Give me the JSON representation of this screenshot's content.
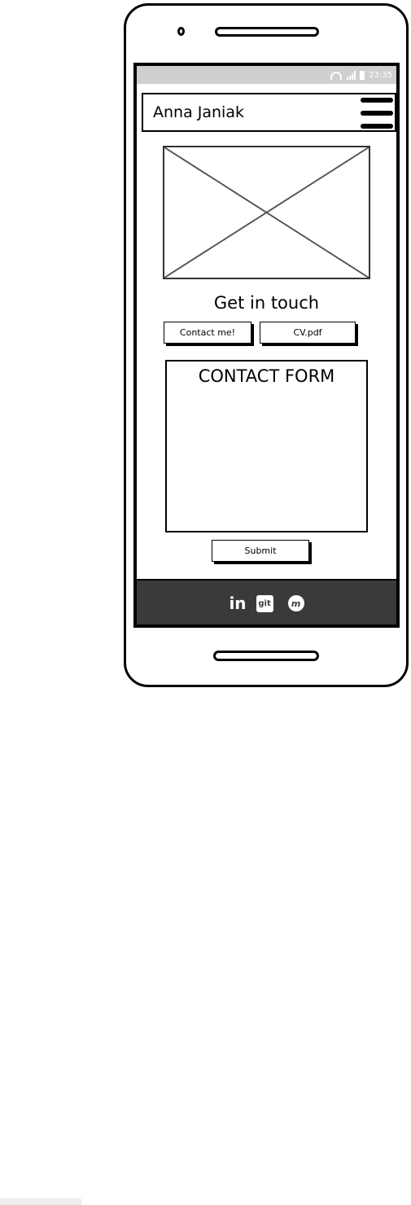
{
  "status_bar": {
    "time": "23:35",
    "icons": [
      "wifi-icon",
      "signal-icon",
      "battery-icon"
    ]
  },
  "app_bar": {
    "title": "Anna Janiak",
    "menu_icon": "hamburger-menu-icon"
  },
  "hero": {
    "image_placeholder_icon": "image-placeholder-icon"
  },
  "contact": {
    "heading": "Get in touch",
    "contact_button": "Contact me!",
    "cv_button": "CV.pdf"
  },
  "form": {
    "title": "CONTACT FORM",
    "submit_label": "Submit"
  },
  "footer": {
    "linkedin_label": "in",
    "git_label": "git",
    "meetup_label": "m",
    "background_color": "#3a3a3a"
  }
}
